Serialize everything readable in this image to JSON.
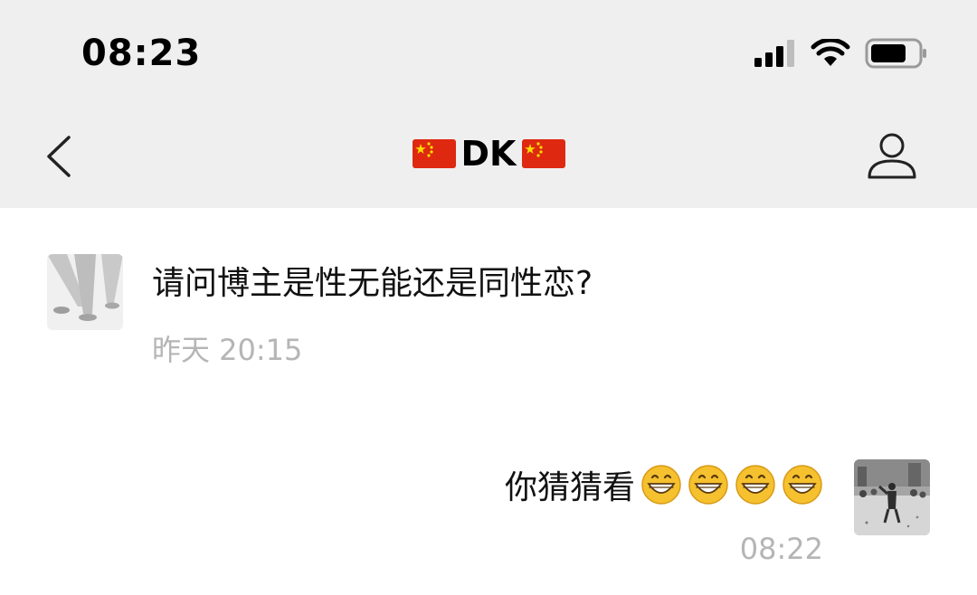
{
  "status_bar": {
    "time": "08:23",
    "icons": [
      "cellular-signal-icon",
      "wifi-icon",
      "battery-icon"
    ]
  },
  "header": {
    "title": "DK",
    "title_decoration": "china-flag-icon",
    "back_icon": "chevron-left-icon",
    "profile_icon": "person-icon"
  },
  "messages": [
    {
      "side": "left",
      "avatar": "spotlight-avatar",
      "text": "请问博主是性无能还是同性恋?",
      "timestamp": "昨天 20:15"
    },
    {
      "side": "right",
      "avatar": "photo-avatar",
      "text": "你猜猜看",
      "emoji": "grinning-face-icon",
      "emoji_count": 4,
      "timestamp": "08:22"
    }
  ],
  "colors": {
    "header_bg": "#efefef",
    "page_bg": "#ffffff",
    "timestamp": "#b5b5b5",
    "flag_red": "#de2910",
    "flag_yellow": "#ffde00",
    "emoji_yellow": "#f5c12e"
  }
}
